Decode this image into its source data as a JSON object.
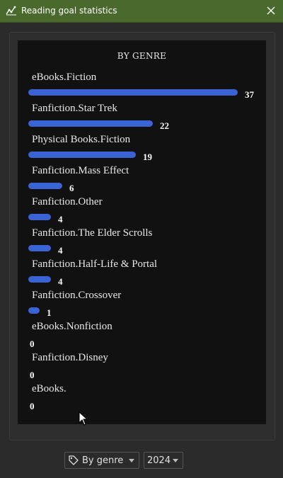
{
  "window": {
    "title": "Reading goal statistics"
  },
  "chart_data": {
    "type": "bar",
    "title": "BY GENRE",
    "categories": [
      "eBooks.Fiction",
      "Fanfiction.Star Trek",
      "Physical Books.Fiction",
      "Fanfiction.Mass Effect",
      "Fanfiction.Other",
      "Fanfiction.The Elder Scrolls",
      "Fanfiction.Half-Life & Portal",
      "Fanfiction.Crossover",
      "eBooks.Nonfiction",
      "Fanfiction.Disney",
      "eBooks."
    ],
    "values": [
      37,
      22,
      19,
      6,
      4,
      4,
      4,
      1,
      0,
      0,
      0
    ],
    "xlim": [
      0,
      37
    ],
    "bar_color": "#3a63d6",
    "grid": false
  },
  "controls": {
    "group_by": {
      "selected": "By genre",
      "icon": "tag-icon"
    },
    "year": {
      "selected": "2024"
    }
  }
}
